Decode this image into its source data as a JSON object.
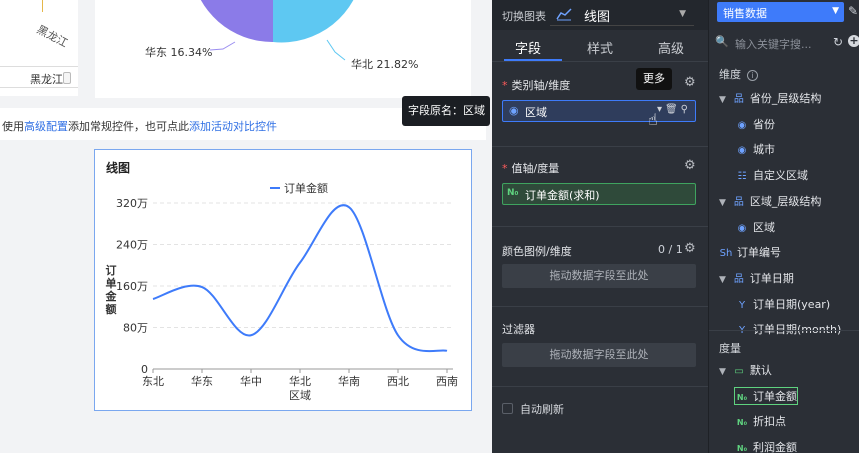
{
  "canvas": {
    "region_label": "黑龙江",
    "bottom_bar_label": "黑龙江",
    "pie_labels": {
      "east": "华东 16.34%",
      "north": "华北 21.82%"
    },
    "helper": {
      "prefix": "使用",
      "link1": "高级配置",
      "middle": "添加常规控件，也可点此",
      "link2": "添加活动对比控件"
    },
    "line_chart_card_title": "线图"
  },
  "chart_data": {
    "type": "line",
    "title": "线图",
    "xlabel": "区域",
    "ylabel": "订单金额",
    "categories": [
      "东北",
      "华东",
      "华中",
      "华北",
      "华南",
      "西北",
      "西南"
    ],
    "series": [
      {
        "name": "订单金额",
        "values": [
          1350000,
          1580000,
          650000,
          2050000,
          3120000,
          650000,
          350000
        ]
      }
    ],
    "y_ticks": [
      "0",
      "80万",
      "160万",
      "240万",
      "320万"
    ],
    "y_tick_values": [
      0,
      800000,
      1600000,
      2400000,
      3200000
    ],
    "ylim": [
      0,
      3200000
    ],
    "legend_position": "top-center",
    "grid": true,
    "series_color": "#3e7bfa"
  },
  "config_panel": {
    "switch_label": "切换图表",
    "chart_type": "线图",
    "tabs": [
      "字段",
      "样式",
      "高级"
    ],
    "active_tab": "字段",
    "category_section": "类别轴/维度",
    "category_field": "区域",
    "more_tooltip": "更多",
    "orig_name_tooltip": "字段原名：区域",
    "value_section": "值轴/度量",
    "value_field": "订单金额(求和)",
    "measure_tag": "N₀",
    "color_section": "颜色图例/维度",
    "color_count": "0 / 1",
    "drop_hint": "拖动数据字段至此处",
    "filter_section": "过滤器",
    "filter_drop_hint": "拖动数据字段至此处",
    "auto_refresh": "自动刷新"
  },
  "data_panel": {
    "dataset": "销售数据",
    "search_placeholder": "输入关键字搜...",
    "dimensions_title": "维度",
    "dimensions": [
      {
        "label": "省份_层级结构",
        "icon": "hierarchy-icon",
        "level": 0,
        "expanded": true
      },
      {
        "label": "省份",
        "icon": "location-icon",
        "level": 1
      },
      {
        "label": "城市",
        "icon": "location-icon",
        "level": 1
      },
      {
        "label": "自定义区域",
        "icon": "custom-region-icon",
        "level": 1
      },
      {
        "label": "区域_层级结构",
        "icon": "hierarchy-icon",
        "level": 0,
        "expanded": true
      },
      {
        "label": "区域",
        "icon": "location-icon",
        "level": 1
      },
      {
        "label": "订单编号",
        "icon": "text-field-icon",
        "level": 0
      },
      {
        "label": "订单日期",
        "icon": "hierarchy-icon",
        "level": 0,
        "expanded": true
      },
      {
        "label": "订单日期(year)",
        "icon": "date-icon",
        "level": 1
      },
      {
        "label": "订单日期(month)",
        "icon": "date-icon",
        "level": 1
      }
    ],
    "measures_title": "度量",
    "measures": [
      {
        "label": "默认",
        "icon": "folder-icon",
        "level": 0,
        "expanded": true
      },
      {
        "label": "订单金额",
        "icon": "number-icon",
        "level": 1,
        "selected": true
      },
      {
        "label": "折扣点",
        "icon": "number-icon",
        "level": 1
      },
      {
        "label": "利润金额",
        "icon": "number-icon",
        "level": 1
      }
    ]
  }
}
